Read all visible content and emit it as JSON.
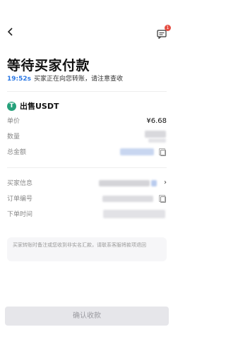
{
  "header": {
    "back_icon": "chevron-left-icon",
    "chat_icon": "chat-icon",
    "chat_badge": "1"
  },
  "title": "等待买家付款",
  "countdown": "19:52s",
  "status_message": "买家正在向您转账，请注意查收",
  "order": {
    "coin_icon": "tether-icon",
    "coin_icon_glyph": "T",
    "type_label": "出售USDT",
    "price_label": "单价",
    "price_value": "¥6.68",
    "quantity_label": "数量",
    "total_label": "总金额",
    "buyer_info_label": "买家信息",
    "order_no_label": "订单编号",
    "order_time_label": "下单时间"
  },
  "notice": "买家转账时备注或您收到非实名汇款，请联系客服将款项退回",
  "confirm_button": "确认收款",
  "colors": {
    "accent": "#2b78e4",
    "coin": "#26a17b",
    "badge": "#e54d42"
  }
}
